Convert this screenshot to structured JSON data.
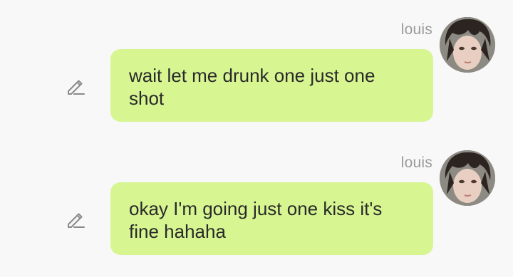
{
  "colors": {
    "background": "#f8f8f8",
    "bubble": "#d7f692",
    "name_text": "#9a9a9a",
    "message_text": "#2a2a2a",
    "icon": "#8a8a8a"
  },
  "messages": [
    {
      "sender": "louis",
      "text": "wait let me drunk one just one shot",
      "avatar_icon": "avatar-image",
      "action_icon": "pencil-edit-icon"
    },
    {
      "sender": "louis",
      "text": "okay I'm going just one kiss it's fine hahaha",
      "avatar_icon": "avatar-image",
      "action_icon": "pencil-edit-icon"
    }
  ]
}
